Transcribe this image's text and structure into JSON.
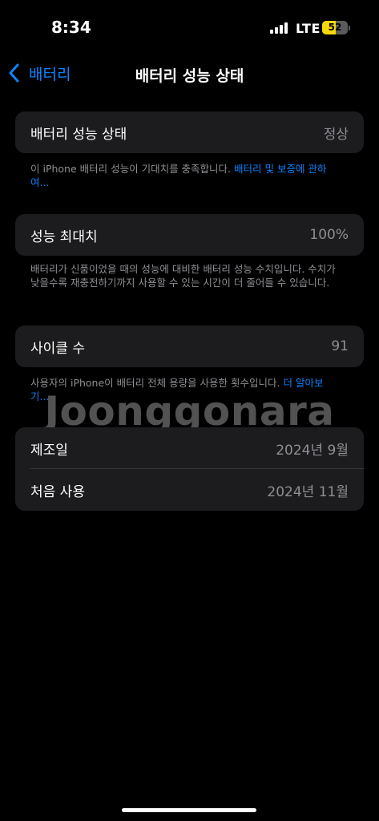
{
  "status_bar": {
    "time": "8:34",
    "network": "LTE",
    "battery_level": "52",
    "battery_percent": 52,
    "battery_color": "#f5d90a"
  },
  "nav": {
    "back_label": "배터리",
    "title": "배터리 성능 상태"
  },
  "health": {
    "label": "배터리 성능 상태",
    "value": "정상",
    "footnote": "이 iPhone 배터리 성능이 기대치를 충족합니다. ",
    "footnote_link": "배터리 및 보증에 관하여..."
  },
  "capacity": {
    "label": "성능 최대치",
    "value": "100%",
    "footnote": "배터리가 신품이었을 때의 성능에 대비한 배터리 성능 수치입니다. 수치가 낮을수록 재충전하기까지 사용할 수 있는 시간이 더 줄어들 수 있습니다."
  },
  "cycles": {
    "label": "사이클 수",
    "value": "91",
    "footnote": "사용자의 iPhone이 배터리 전체 용량을 사용한 횟수입니다. ",
    "footnote_link": "더 알아보기..."
  },
  "info": {
    "manufacture_label": "제조일",
    "manufacture_value": "2024년 9월",
    "first_use_label": "처음 사용",
    "first_use_value": "2024년 11월"
  },
  "watermark": "Joonggonara",
  "colors": {
    "accent": "#0a84ff",
    "background": "#000000",
    "card": "#1c1c1e",
    "secondary_text": "#8e8e93"
  }
}
